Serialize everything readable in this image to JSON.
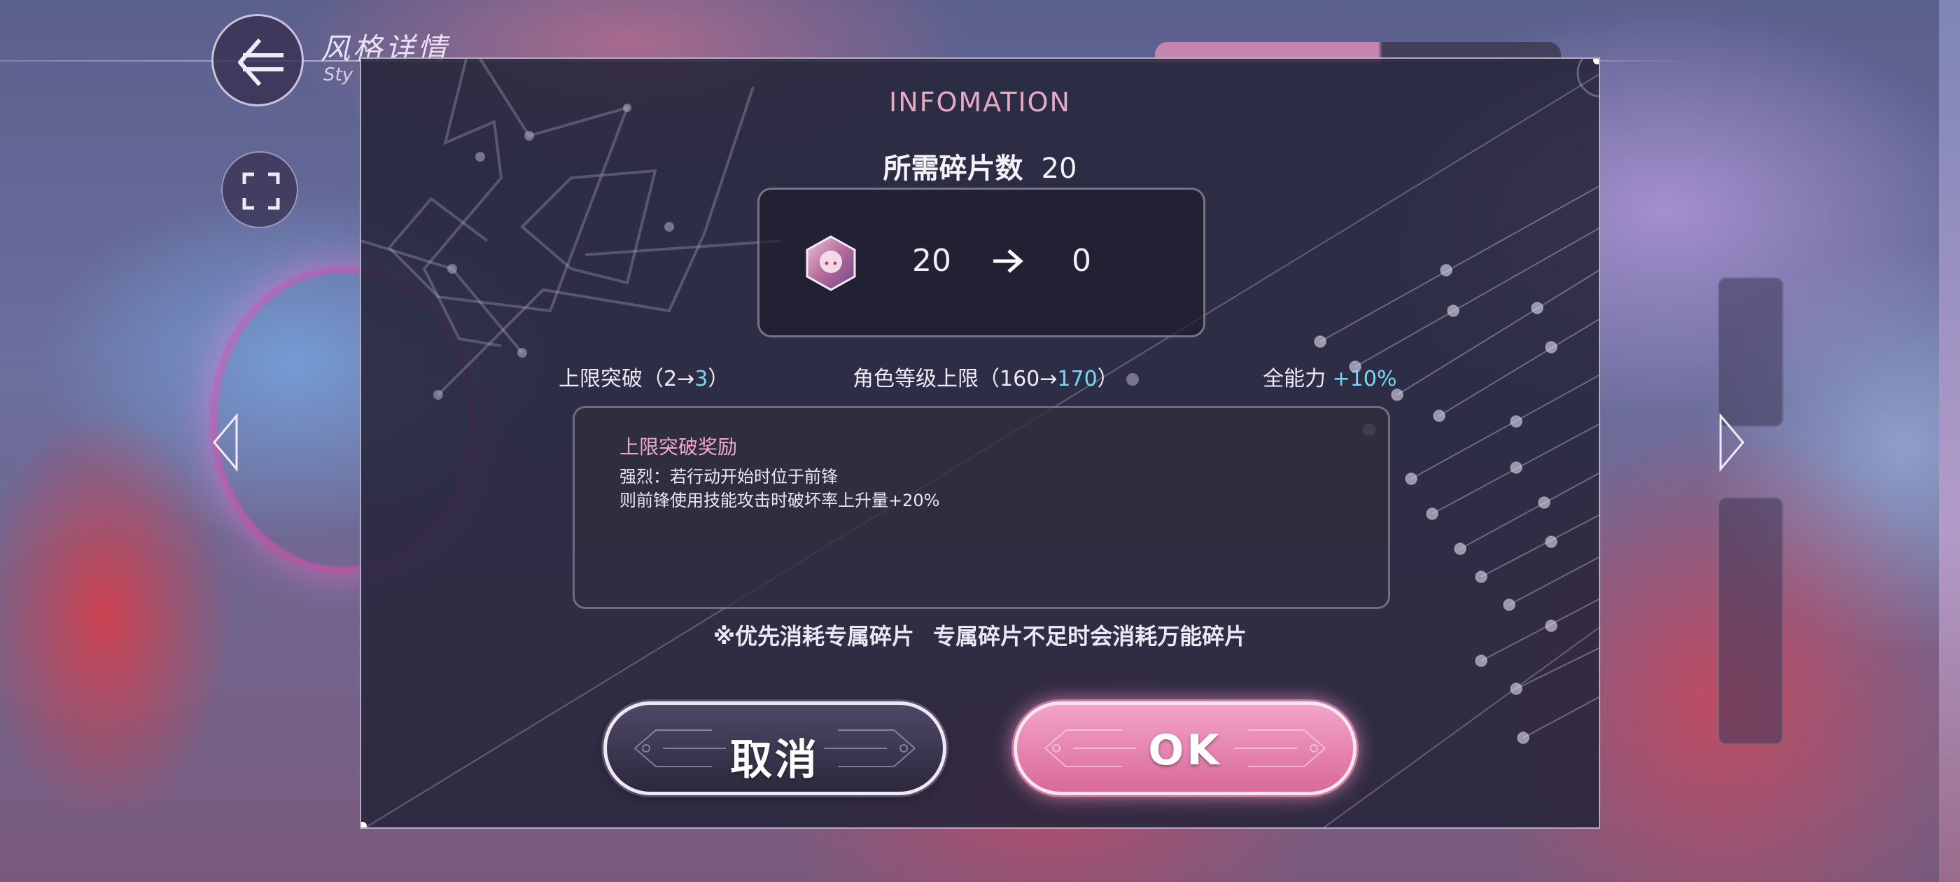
{
  "header": {
    "title": "风格详情",
    "subtitle": "Sty"
  },
  "dialog": {
    "title": "INFOMATION",
    "required_label": "所需碎片数",
    "required_count": "20",
    "fragments": {
      "icon": "character-fragment-icon",
      "from": "20",
      "to": "0"
    },
    "stats": [
      {
        "label": "上限突破（2→",
        "value": "3",
        "suffix": "）"
      },
      {
        "label": "角色等级上限（160→",
        "value": "170",
        "suffix": "）"
      },
      {
        "label": "全能力",
        "value": "+10%",
        "suffix": ""
      }
    ],
    "bonus": {
      "title": "上限突破奖励",
      "line1": "强烈：若行动开始时位于前锋",
      "line2": "则前锋使用技能攻击时破坏率上升量+20%"
    },
    "note": "※优先消耗专属碎片 专属碎片不足时会消耗万能碎片",
    "cancel_label": "取消",
    "ok_label": "OK"
  },
  "colors": {
    "title_pink": "#e7a8c3",
    "highlight_cyan": "#77d6f2",
    "ok_pink": "#e27fae",
    "cancel_dark": "#3a3550"
  }
}
